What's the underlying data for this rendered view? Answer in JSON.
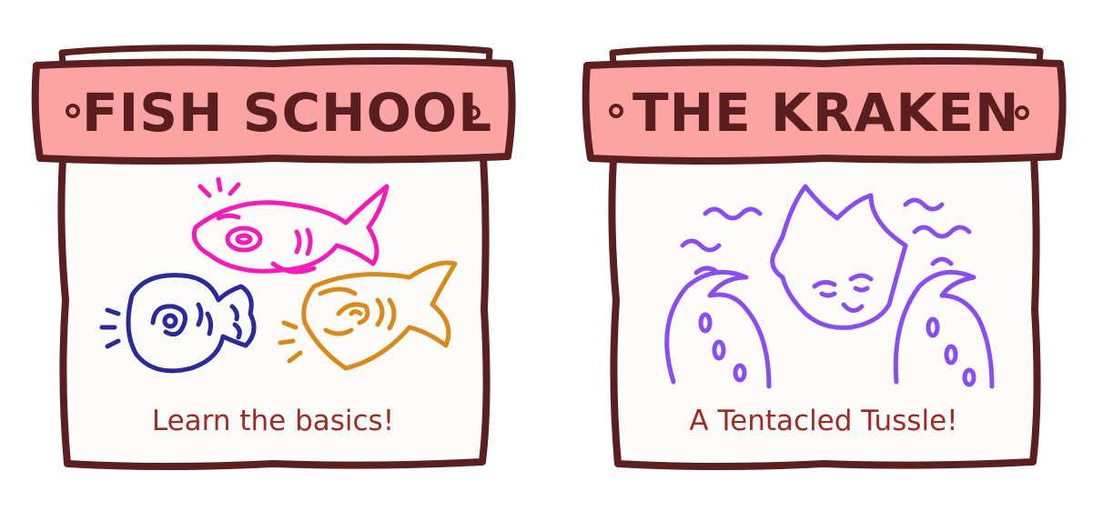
{
  "levels": [
    {
      "title": "FISH SCHOOL",
      "subtitle": "Learn the basics!",
      "art": [
        "pink-fish-icon",
        "blue-pufferfish-icon",
        "orange-angelfish-icon"
      ]
    },
    {
      "title": "THE KRAKEN",
      "subtitle": "A Tentacled Tussle!",
      "art": [
        "kraken-icon",
        "tentacle-icon"
      ]
    }
  ],
  "colors": {
    "frame": "#5c1f1f",
    "banner": "#fca4a4",
    "panel": "#fdfcfb",
    "title_text": "#5a1e1e",
    "subtitle_text": "#a12a22",
    "fish_pink": "#f21cb8",
    "fish_blue": "#2a2a9a",
    "fish_orange": "#d98a1a",
    "kraken": "#8a4ef0"
  }
}
